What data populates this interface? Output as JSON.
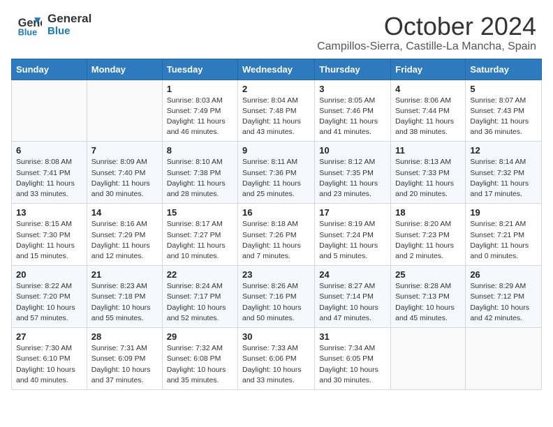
{
  "header": {
    "logo_line1": "General",
    "logo_line2": "Blue",
    "month_title": "October 2024",
    "location": "Campillos-Sierra, Castille-La Mancha, Spain"
  },
  "days_of_week": [
    "Sunday",
    "Monday",
    "Tuesday",
    "Wednesday",
    "Thursday",
    "Friday",
    "Saturday"
  ],
  "weeks": [
    [
      {
        "day": "",
        "info": ""
      },
      {
        "day": "",
        "info": ""
      },
      {
        "day": "1",
        "info": "Sunrise: 8:03 AM\nSunset: 7:49 PM\nDaylight: 11 hours and 46 minutes."
      },
      {
        "day": "2",
        "info": "Sunrise: 8:04 AM\nSunset: 7:48 PM\nDaylight: 11 hours and 43 minutes."
      },
      {
        "day": "3",
        "info": "Sunrise: 8:05 AM\nSunset: 7:46 PM\nDaylight: 11 hours and 41 minutes."
      },
      {
        "day": "4",
        "info": "Sunrise: 8:06 AM\nSunset: 7:44 PM\nDaylight: 11 hours and 38 minutes."
      },
      {
        "day": "5",
        "info": "Sunrise: 8:07 AM\nSunset: 7:43 PM\nDaylight: 11 hours and 36 minutes."
      }
    ],
    [
      {
        "day": "6",
        "info": "Sunrise: 8:08 AM\nSunset: 7:41 PM\nDaylight: 11 hours and 33 minutes."
      },
      {
        "day": "7",
        "info": "Sunrise: 8:09 AM\nSunset: 7:40 PM\nDaylight: 11 hours and 30 minutes."
      },
      {
        "day": "8",
        "info": "Sunrise: 8:10 AM\nSunset: 7:38 PM\nDaylight: 11 hours and 28 minutes."
      },
      {
        "day": "9",
        "info": "Sunrise: 8:11 AM\nSunset: 7:36 PM\nDaylight: 11 hours and 25 minutes."
      },
      {
        "day": "10",
        "info": "Sunrise: 8:12 AM\nSunset: 7:35 PM\nDaylight: 11 hours and 23 minutes."
      },
      {
        "day": "11",
        "info": "Sunrise: 8:13 AM\nSunset: 7:33 PM\nDaylight: 11 hours and 20 minutes."
      },
      {
        "day": "12",
        "info": "Sunrise: 8:14 AM\nSunset: 7:32 PM\nDaylight: 11 hours and 17 minutes."
      }
    ],
    [
      {
        "day": "13",
        "info": "Sunrise: 8:15 AM\nSunset: 7:30 PM\nDaylight: 11 hours and 15 minutes."
      },
      {
        "day": "14",
        "info": "Sunrise: 8:16 AM\nSunset: 7:29 PM\nDaylight: 11 hours and 12 minutes."
      },
      {
        "day": "15",
        "info": "Sunrise: 8:17 AM\nSunset: 7:27 PM\nDaylight: 11 hours and 10 minutes."
      },
      {
        "day": "16",
        "info": "Sunrise: 8:18 AM\nSunset: 7:26 PM\nDaylight: 11 hours and 7 minutes."
      },
      {
        "day": "17",
        "info": "Sunrise: 8:19 AM\nSunset: 7:24 PM\nDaylight: 11 hours and 5 minutes."
      },
      {
        "day": "18",
        "info": "Sunrise: 8:20 AM\nSunset: 7:23 PM\nDaylight: 11 hours and 2 minutes."
      },
      {
        "day": "19",
        "info": "Sunrise: 8:21 AM\nSunset: 7:21 PM\nDaylight: 11 hours and 0 minutes."
      }
    ],
    [
      {
        "day": "20",
        "info": "Sunrise: 8:22 AM\nSunset: 7:20 PM\nDaylight: 10 hours and 57 minutes."
      },
      {
        "day": "21",
        "info": "Sunrise: 8:23 AM\nSunset: 7:18 PM\nDaylight: 10 hours and 55 minutes."
      },
      {
        "day": "22",
        "info": "Sunrise: 8:24 AM\nSunset: 7:17 PM\nDaylight: 10 hours and 52 minutes."
      },
      {
        "day": "23",
        "info": "Sunrise: 8:26 AM\nSunset: 7:16 PM\nDaylight: 10 hours and 50 minutes."
      },
      {
        "day": "24",
        "info": "Sunrise: 8:27 AM\nSunset: 7:14 PM\nDaylight: 10 hours and 47 minutes."
      },
      {
        "day": "25",
        "info": "Sunrise: 8:28 AM\nSunset: 7:13 PM\nDaylight: 10 hours and 45 minutes."
      },
      {
        "day": "26",
        "info": "Sunrise: 8:29 AM\nSunset: 7:12 PM\nDaylight: 10 hours and 42 minutes."
      }
    ],
    [
      {
        "day": "27",
        "info": "Sunrise: 7:30 AM\nSunset: 6:10 PM\nDaylight: 10 hours and 40 minutes."
      },
      {
        "day": "28",
        "info": "Sunrise: 7:31 AM\nSunset: 6:09 PM\nDaylight: 10 hours and 37 minutes."
      },
      {
        "day": "29",
        "info": "Sunrise: 7:32 AM\nSunset: 6:08 PM\nDaylight: 10 hours and 35 minutes."
      },
      {
        "day": "30",
        "info": "Sunrise: 7:33 AM\nSunset: 6:06 PM\nDaylight: 10 hours and 33 minutes."
      },
      {
        "day": "31",
        "info": "Sunrise: 7:34 AM\nSunset: 6:05 PM\nDaylight: 10 hours and 30 minutes."
      },
      {
        "day": "",
        "info": ""
      },
      {
        "day": "",
        "info": ""
      }
    ]
  ]
}
